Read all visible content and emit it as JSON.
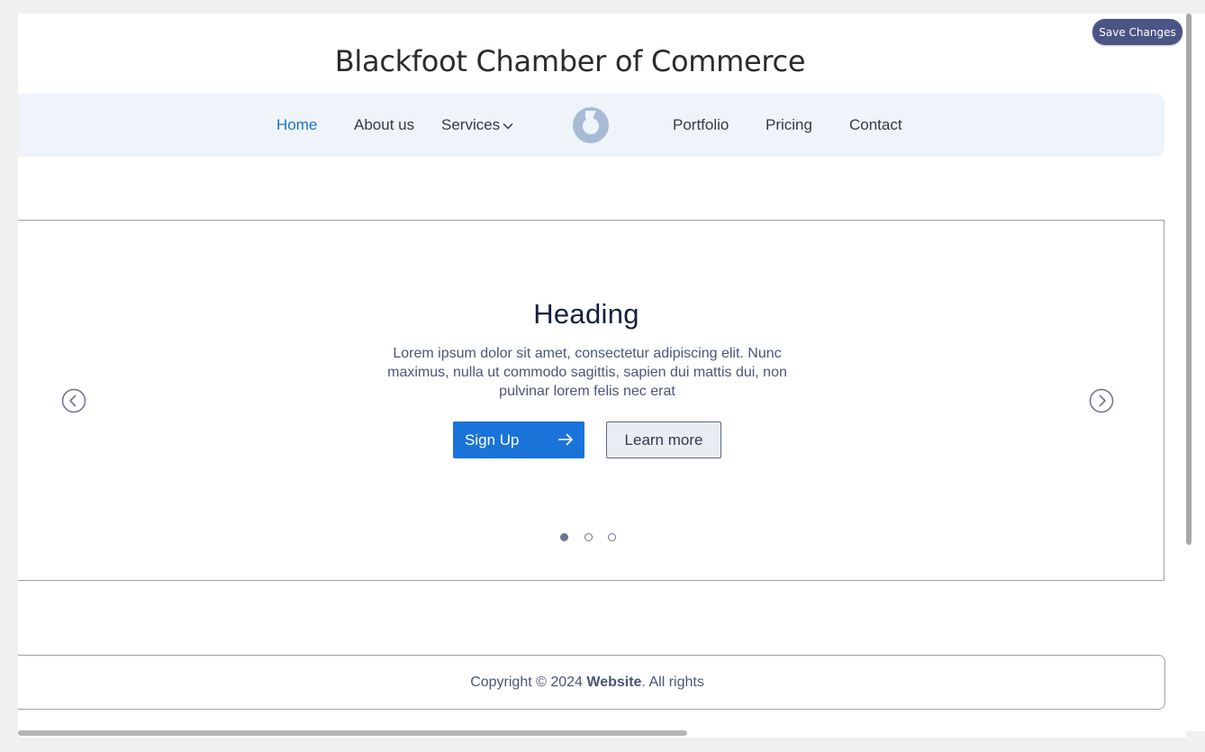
{
  "toolbar": {
    "save_label": "Save Changes"
  },
  "site": {
    "title": "Blackfoot Chamber of Commerce"
  },
  "nav": {
    "items": [
      {
        "label": "Home",
        "active": true
      },
      {
        "label": "About us",
        "active": false
      },
      {
        "label": "Services",
        "active": false,
        "icon": "chevron-down-icon"
      },
      {
        "label": "Portfolio",
        "active": false
      },
      {
        "label": "Pricing",
        "active": false
      },
      {
        "label": "Contact",
        "active": false
      }
    ],
    "logo_icon": "logo-icon"
  },
  "hero": {
    "heading": "Heading",
    "text": "Lorem ipsum dolor sit amet, consectetur adipiscing elit. Nunc maximus, nulla ut commodo sagittis, sapien dui mattis dui, non pulvinar lorem felis nec erat",
    "primary_button": "Sign Up",
    "secondary_button": "Learn more",
    "prev_icon": "chevron-left-circle-icon",
    "next_icon": "chevron-right-circle-icon",
    "slides_count": 3,
    "active_slide": 1
  },
  "footer": {
    "prefix": "Copyright © 2024 ",
    "brand": "Website",
    "suffix": ". All rights"
  },
  "colors": {
    "accent": "#1a73d9",
    "nav_active": "#1c74c9",
    "nav_background": "#eff4fb",
    "save_button": "#4a5585",
    "heading": "#12213f"
  }
}
